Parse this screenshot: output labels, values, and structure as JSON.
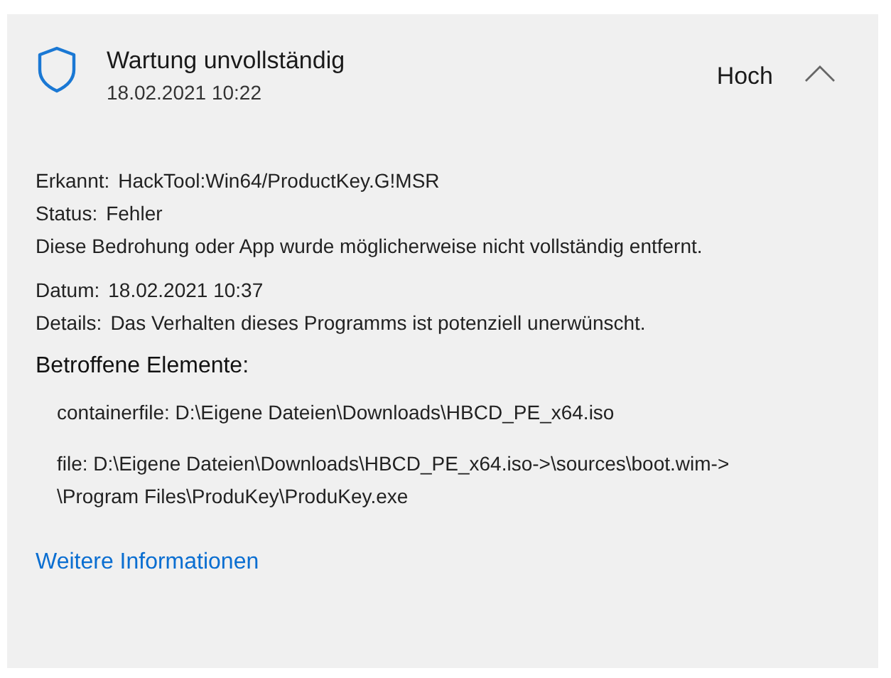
{
  "header": {
    "title": "Wartung unvollständig",
    "date": "18.02.2021 10:22",
    "severity": "Hoch",
    "expanded": true
  },
  "detection": [
    {
      "label": "Erkannt:",
      "value": "HackTool:Win64/ProductKey.G!MSR"
    },
    {
      "label": "Status:",
      "value": "Fehler"
    }
  ],
  "status_note": "Diese Bedrohung oder App wurde möglicherweise nicht vollständig entfernt.",
  "info": [
    {
      "label": "Datum:",
      "value": "18.02.2021 10:37"
    },
    {
      "label": "Details:",
      "value": "Das Verhalten dieses Programms ist potenziell unerwünscht."
    }
  ],
  "affected_heading": "Betroffene Elemente:",
  "affected_items": [
    {
      "lines": [
        "containerfile: D:\\Eigene Dateien\\Downloads\\HBCD_PE_x64.iso"
      ]
    },
    {
      "lines": [
        "file: D:\\Eigene Dateien\\Downloads\\HBCD_PE_x64.iso->\\sources\\boot.wim->",
        "\\Program Files\\ProduKey\\ProduKey.exe"
      ]
    }
  ],
  "link": "Weitere Informationen"
}
